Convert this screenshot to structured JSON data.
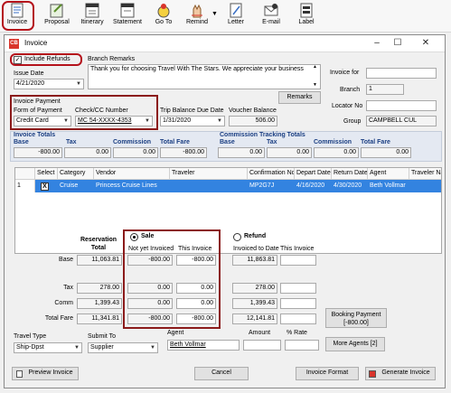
{
  "toolbar": {
    "items": [
      {
        "label": "Invoice",
        "icon": "invoice-icon"
      },
      {
        "label": "Proposal",
        "icon": "proposal-icon"
      },
      {
        "label": "Itinerary",
        "icon": "itinerary-icon"
      },
      {
        "label": "Statement",
        "icon": "statement-icon"
      },
      {
        "label": "Go To",
        "icon": "goto-icon"
      },
      {
        "label": "Remind",
        "icon": "remind-icon"
      },
      {
        "label": "Letter",
        "icon": "letter-icon"
      },
      {
        "label": "E-mail",
        "icon": "email-icon"
      },
      {
        "label": "Label",
        "icon": "label-icon"
      }
    ]
  },
  "window": {
    "app_badge": "CB",
    "title": "Invoice"
  },
  "header": {
    "include_refunds_label": "Include Refunds",
    "include_refunds_checked": true,
    "issue_date_label": "Issue Date",
    "issue_date": "4/21/2020",
    "branch_remarks_label": "Branch Remarks",
    "branch_remarks": "Thank you for choosing Travel With The Stars.  We appreciate your business",
    "remarks_button": "Remarks",
    "invoice_for_label": "Invoice for",
    "invoice_for": "",
    "branch_label": "Branch",
    "branch": "1",
    "locator_label": "Locator No",
    "locator": "",
    "group_label": "Group",
    "group": "CAMPBELL CUL"
  },
  "payment": {
    "section_label": "Invoice Payment",
    "form_label": "Form of Payment",
    "form_value": "Credit Card",
    "check_label": "Check/CC Number",
    "check_value": "MC 54-XXXX-4353",
    "trip_due_label": "Trip Balance Due Date",
    "trip_due_value": "1/31/2020",
    "voucher_label": "Voucher Balance",
    "voucher_value": "506.00"
  },
  "totals": {
    "invoice_totals_label": "Invoice Totals",
    "commission_tracking_label": "Commission Tracking Totals",
    "col_base": "Base",
    "col_tax": "Tax",
    "col_commission": "Commission",
    "col_total_fare": "Total Fare",
    "invoice": {
      "base": "-800.00",
      "tax": "0.00",
      "commission": "0.00",
      "total_fare": "-800.00"
    },
    "tracking": {
      "base": "0.00",
      "tax": "0.00",
      "commission": "0.00",
      "total_fare": "0.00"
    }
  },
  "grid": {
    "headers": [
      "",
      "Select",
      "Category",
      "Vendor",
      "Traveler",
      "Confirmation No",
      "Depart Date",
      "Return Date",
      "Agent",
      "Traveler Na"
    ],
    "rows": [
      {
        "num": "1",
        "select": "X",
        "category": "Cruise",
        "vendor": "Princess Cruise Lines",
        "traveler": "",
        "confirmation": "MP2G7J",
        "depart": "4/16/2020",
        "return": "4/30/2020",
        "agent": "Beth Vollmar",
        "traveler_name": ""
      }
    ]
  },
  "detail": {
    "reservation_total_label": "Reservation Total",
    "sale_label": "Sale",
    "refund_label": "Refund",
    "sale_selected": true,
    "not_yet_invoiced_label": "Not yet Invoiced",
    "this_invoice_label": "This Invoice",
    "invoiced_to_date_label": "Invoiced to Date",
    "refund_this_invoice_label": "This Invoice",
    "row_labels": [
      "Base",
      "Tax",
      "Comm",
      "Total Fare"
    ],
    "reservation_total": [
      "11,063.81",
      "278.00",
      "1,399.43",
      "11,341.81"
    ],
    "not_yet_invoiced": [
      "-800.00",
      "0.00",
      "0.00",
      "-800.00"
    ],
    "this_invoice": [
      "-800.00",
      "0.00",
      "0.00",
      "-800.00"
    ],
    "invoiced_to_date": [
      "11,863.81",
      "278.00",
      "1,399.43",
      "12,141.81"
    ],
    "refund_this_invoice": [
      "",
      "",
      "",
      ""
    ],
    "booking_payment_label": "Booking Payment",
    "booking_payment_value": "[-800.00]"
  },
  "bottom": {
    "travel_type_label": "Travel Type",
    "travel_type": "Ship-Dpst",
    "submit_to_label": "Submit To",
    "submit_to": "Supplier",
    "agent_label": "Agent",
    "agent": "Beth Vollmar",
    "amount_label": "Amount",
    "amount": "",
    "rate_label": "% Rate",
    "rate": "",
    "more_agents": "More Agents [2]"
  },
  "footer": {
    "preview": "Preview Invoice",
    "cancel": "Cancel",
    "invoice_format": "Invoice Format",
    "generate": "Generate Invoice"
  },
  "colors": {
    "accent_red": "#b5121b",
    "selection_blue": "#3383e0",
    "header_blue": "#1a3e82"
  }
}
